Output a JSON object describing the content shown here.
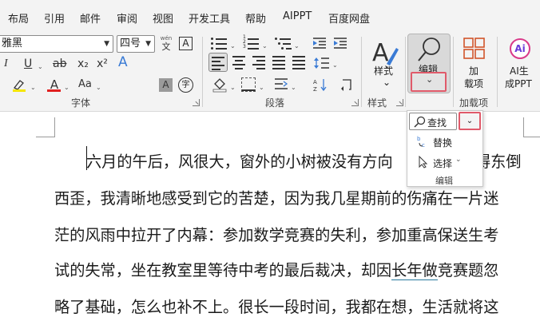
{
  "tabs": [
    "布局",
    "引用",
    "邮件",
    "审阅",
    "视图",
    "开发工具",
    "帮助",
    "AIPPT",
    "百度网盘"
  ],
  "font": {
    "name": "雅黑",
    "size": "四号",
    "phonetic_icon_top": "wén",
    "phonetic_icon_bottom": "文",
    "border_char": "A",
    "italic": "I",
    "underline": "U",
    "strike": "ab",
    "subscript": "x₂",
    "superscript": "x²",
    "text_effect_char": "A",
    "font_color_char": "A",
    "change_case": "Aa",
    "shading_char": "A",
    "enclose_char": "字",
    "group_label": "字体"
  },
  "paragraph": {
    "group_label": "段落"
  },
  "styles": {
    "label": "样式",
    "group_label": "样式"
  },
  "editing": {
    "label": "编辑"
  },
  "addins": {
    "label_line1": "加",
    "label_line2": "载项",
    "group_label": "加载项"
  },
  "ai": {
    "badge": "Ai",
    "label_line1": "AI生",
    "label_line2": "成PPT"
  },
  "dropdown": {
    "find": "查找",
    "replace": "替换",
    "select": "选择",
    "group_label": "编辑"
  },
  "colors": {
    "highlight": "#f5e600",
    "font_color": "#e02020",
    "red_outline": "#e05a6a",
    "ai_badge": "#d93a8a"
  },
  "document": {
    "lines": [
      "六月的午后，风很大，窗外的小树被没有方向",
      "西歪，我清晰地感受到它的苦楚，因为我几星期前的伤痛在一片迷",
      "茫的风雨中拉开了内幕：参加数学竞赛的失利，参加重高保送生考",
      "的失常，坐在教室里等待中考的最后裁决，却因",
      "略了基础，怎么也补不上。很长一段时间，我都在想，生活就将这"
    ],
    "line1_tail": "得东倒",
    "line4_start": "试",
    "line4_underlined": "长年做",
    "line4_end": "竞赛题忽"
  }
}
